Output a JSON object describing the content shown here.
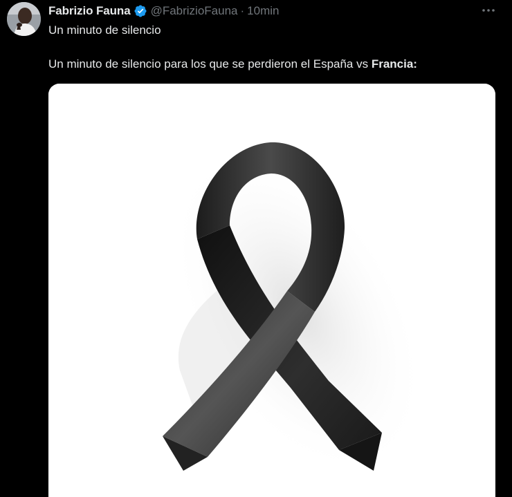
{
  "tweet": {
    "author_name": "Fabrizio Fauna",
    "handle": "@FabrizioFauna",
    "separator": "·",
    "time": "10min",
    "text_line1": "Un minuto de silencio",
    "text_line2_regular": "Un minuto de silencio para los que se perdieron el España vs ",
    "text_line2_bold": "Francia:",
    "verified_color": "#1d9bf0",
    "image_subject": "black-ribbon"
  },
  "icons": {
    "verified": "verified-badge-icon",
    "more": "more-options-icon"
  }
}
